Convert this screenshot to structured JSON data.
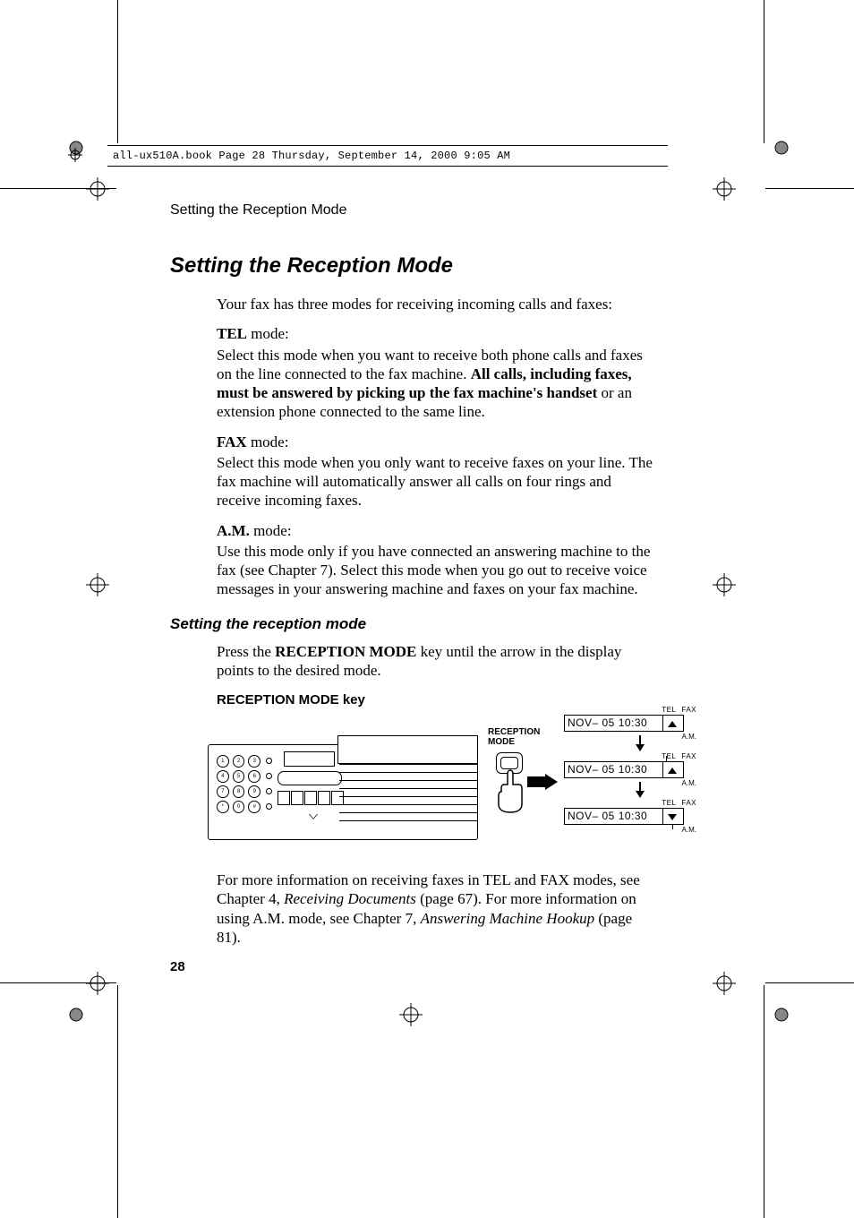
{
  "meta_line": "all-ux510A.book  Page 28  Thursday, September 14, 2000  9:05 AM",
  "running_head": "Setting the Reception Mode",
  "title": "Setting the Reception Mode",
  "intro": "Your fax has three modes for receiving incoming calls and faxes:",
  "tel": {
    "label": "TEL",
    "suffix": " mode:",
    "body_pre": "Select this mode when you want to receive both phone calls and faxes on the line connected to the fax machine. ",
    "body_bold": "All calls, including faxes, must be answered by picking up the fax machine's handset",
    "body_post": " or an extension phone connected to the same line."
  },
  "fax": {
    "label": "FAX",
    "suffix": " mode:",
    "body": "Select this mode when you only want to receive faxes on your line. The fax machine will automatically answer all calls on four rings and receive incoming faxes."
  },
  "am": {
    "label": "A.M.",
    "suffix": " mode:",
    "body": "Use this mode only if you have connected an answering machine to the fax (see Chapter 7). Select this mode when you go out to receive voice messages in your answering machine and faxes on your fax machine."
  },
  "subhead": "Setting the reception mode",
  "instruction_pre": "Press the ",
  "instruction_bold": "RECEPTION MODE",
  "instruction_post": " key until the arrow in the display points to the desired mode.",
  "diagram": {
    "title": "RECEPTION MODE key",
    "button_label_line1": "RECEPTION",
    "button_label_line2": "MODE",
    "labels": {
      "tel": "TEL",
      "fax": "FAX",
      "am": "A.M."
    },
    "lcd_text": "NOV– 05  10:30",
    "keypad": [
      "1",
      "2",
      "3",
      "4",
      "5",
      "6",
      "7",
      "8",
      "9",
      "*",
      "0",
      "#"
    ]
  },
  "footnote": {
    "p1a": "For more information on receiving faxes in TEL and FAX modes, see Chapter 4, ",
    "p1i": "Receiving Documents",
    "p1b": " (page 67). For more information on using A.M. mode, see Chapter 7, ",
    "p2i": "Answering Machine Hookup",
    "p2b": " (page 81)."
  },
  "page_number": "28"
}
